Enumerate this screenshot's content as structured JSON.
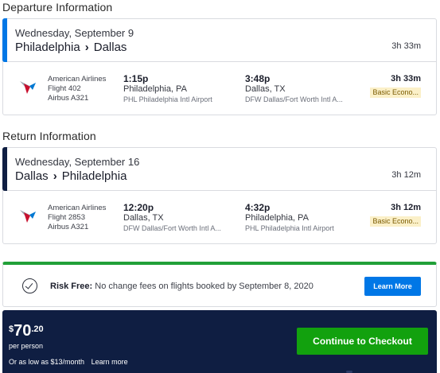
{
  "departure": {
    "section_title": "Departure Information",
    "date": "Wednesday, September 9",
    "from": "Philadelphia",
    "to": "Dallas",
    "duration": "3h 33m",
    "accent_color": "#0077e6",
    "segment": {
      "airline_logo": "american-airlines-logo-icon",
      "airline": "American Airlines",
      "flight": "Flight 402",
      "aircraft": "Airbus A321",
      "depart_time": "1:15p",
      "depart_city": "Philadelphia, PA",
      "depart_airport": "PHL Philadelphia Intl Airport",
      "arrive_time": "3:48p",
      "arrive_city": "Dallas, TX",
      "arrive_airport": "DFW Dallas/Fort Worth Intl A...",
      "duration": "3h 33m",
      "fare_class": "Basic Econo..."
    }
  },
  "return": {
    "section_title": "Return Information",
    "date": "Wednesday, September 16",
    "from": "Dallas",
    "to": "Philadelphia",
    "duration": "3h 12m",
    "accent_color": "#0f1e42",
    "segment": {
      "airline_logo": "american-airlines-logo-icon",
      "airline": "American Airlines",
      "flight": "Flight 2853",
      "aircraft": "Airbus A321",
      "depart_time": "12:20p",
      "depart_city": "Dallas, TX",
      "depart_airport": "DFW Dallas/Fort Worth Intl A...",
      "arrive_time": "4:32p",
      "arrive_city": "Philadelphia, PA",
      "arrive_airport": "PHL Philadelphia Intl Airport",
      "duration": "3h 12m",
      "fare_class": "Basic Econo..."
    }
  },
  "risk_free": {
    "icon": "check-circle-icon",
    "label": "Risk Free:",
    "text": "No change fees on flights booked by September 8, 2020",
    "button": "Learn More",
    "accent_color": "#21a038"
  },
  "checkout_bar": {
    "currency": "$",
    "price_int": "70",
    "price_cents": ".20",
    "per_person": "per person",
    "as_low_as": "Or as low as $13/month",
    "learn_more": "Learn more",
    "button": "Continue to Checkout",
    "button_color": "#12a10e",
    "bar_color": "#0f1e42"
  }
}
